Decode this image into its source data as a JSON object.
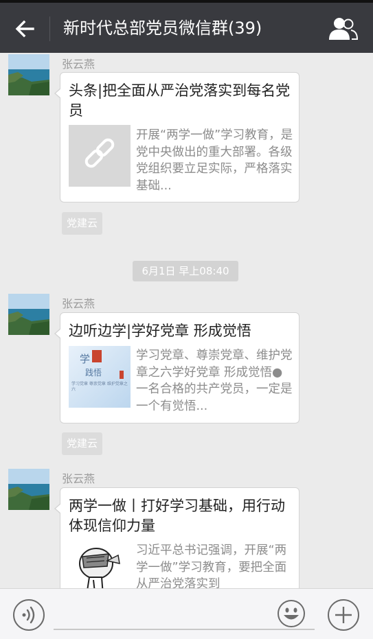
{
  "header": {
    "title": "新时代总部党员微信群(39)"
  },
  "messages": [
    {
      "sender": "张云燕",
      "title": "头条|把全面从严治党落实到每名党员",
      "description": "开展“两学一做”学习教育，是党中央做出的重大部署。各级党组织要立足实际，严格落实基础...",
      "thumbnail": "link-icon",
      "source": "党建云"
    },
    {
      "sender": "张云燕",
      "title": "边听边学|学好党章 形成觉悟",
      "description": "学习党章、尊崇党章、维护党章之六学好党章 形成觉悟● 一名合格的共产党员，一定是一个有觉悟...",
      "thumbnail": "study-banner-image",
      "source": "党建云"
    },
    {
      "sender": "张云燕",
      "title": "两学一做丨打好学习基础，用行动体现信仰力量",
      "description": "习近平总书记强调，开展“两学一做”学习教育，要把全面从严治党落实到",
      "thumbnail": "cartoon-image"
    }
  ],
  "timestamp": "6月1日 早上08:40",
  "thumb_text": {
    "line1": "学",
    "line2": "践悟",
    "small": "学习党章 尊崇党章 维护党章之六"
  },
  "colors": {
    "header_bg": "#393a3f",
    "chat_bg": "#ebebeb",
    "input_bg": "#f5f5f7"
  }
}
